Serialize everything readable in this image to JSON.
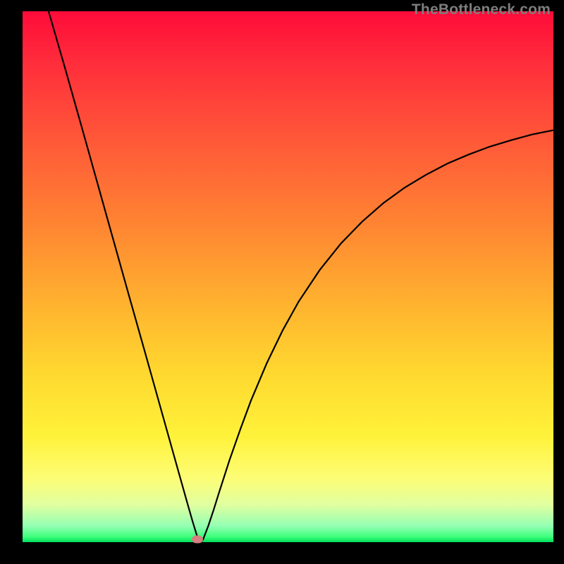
{
  "watermark": "TheBottleneck.com",
  "chart_data": {
    "type": "line",
    "title": "",
    "xlabel": "",
    "ylabel": "",
    "xlim": [
      0,
      100
    ],
    "ylim": [
      0,
      100
    ],
    "curve_points": [
      [
        4.9,
        100.0
      ],
      [
        8.0,
        89.3
      ],
      [
        11.0,
        78.7
      ],
      [
        14.0,
        68.0
      ],
      [
        17.0,
        57.3
      ],
      [
        20.0,
        46.6
      ],
      [
        23.0,
        36.0
      ],
      [
        26.0,
        25.3
      ],
      [
        29.0,
        14.6
      ],
      [
        31.0,
        7.5
      ],
      [
        32.0,
        4.0
      ],
      [
        32.8,
        1.4
      ],
      [
        33.2,
        0.4
      ],
      [
        33.6,
        0.0
      ],
      [
        34.0,
        0.5
      ],
      [
        35.0,
        3.1
      ],
      [
        36.0,
        6.1
      ],
      [
        37.0,
        9.3
      ],
      [
        39.0,
        15.5
      ],
      [
        41.0,
        21.2
      ],
      [
        43.0,
        26.6
      ],
      [
        46.0,
        33.7
      ],
      [
        49.0,
        39.9
      ],
      [
        52.0,
        45.3
      ],
      [
        56.0,
        51.3
      ],
      [
        60.0,
        56.3
      ],
      [
        64.0,
        60.4
      ],
      [
        68.0,
        63.9
      ],
      [
        72.0,
        66.8
      ],
      [
        76.0,
        69.2
      ],
      [
        80.0,
        71.3
      ],
      [
        84.0,
        73.0
      ],
      [
        88.0,
        74.5
      ],
      [
        92.0,
        75.7
      ],
      [
        96.0,
        76.8
      ],
      [
        100.0,
        77.6
      ]
    ],
    "marker": {
      "x": 33.0,
      "y": 0.5
    },
    "gradient_stops": [
      {
        "pct": 0,
        "color": "#ff0b3a"
      },
      {
        "pct": 25,
        "color": "#ff5a38"
      },
      {
        "pct": 55,
        "color": "#ffb22f"
      },
      {
        "pct": 80,
        "color": "#fff23a"
      },
      {
        "pct": 97,
        "color": "#93ffb3"
      },
      {
        "pct": 100,
        "color": "#00e05e"
      }
    ]
  }
}
